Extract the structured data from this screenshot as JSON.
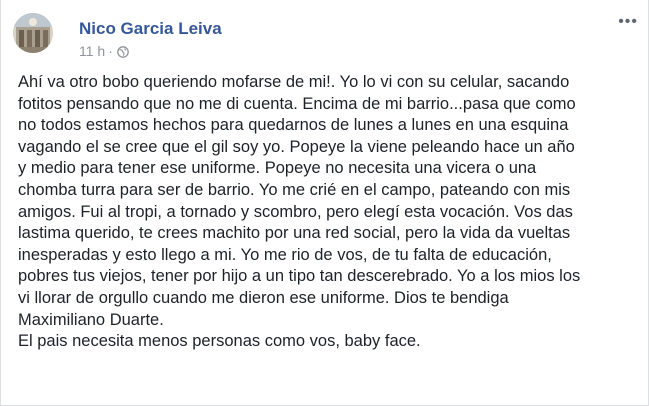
{
  "post": {
    "author": "Nico Garcia Leiva",
    "time": "11 h",
    "separator": "·",
    "privacy_icon": "globe-icon",
    "more_icon": "more-options-icon",
    "more_label": "•••",
    "lines": [
      "Ahí va otro bobo queriendo mofarse de mi!. Yo lo vi con su celular, sacando",
      "fotitos pensando que no me di cuenta. Encima de mi barrio...pasa que como",
      "no todos estamos hechos para quedarnos de lunes a lunes en una esquina",
      "vagando el se cree que el gil soy yo. Popeye la viene peleando hace un año",
      "y medio para tener ese uniforme. Popeye no necesita una vicera o una",
      "chomba turra para ser de barrio. Yo me crié en el campo, pateando con mis",
      "amigos. Fui al tropi, a tornado y scombro, pero elegí esta vocación. Vos das",
      "lastima querido, te crees machito por una red social, pero la vida da vueltas",
      "inesperadas y esto llego a mi. Yo me rio de vos, de tu falta de educación,",
      "pobres tus viejos, tener por hijo a un tipo tan descerebrado. Yo a los mios los",
      "vi llorar de orgullo cuando me dieron ese uniforme. Dios te bendiga",
      "Maximiliano Duarte.",
      "El pais necesita menos personas como vos, baby face."
    ]
  }
}
